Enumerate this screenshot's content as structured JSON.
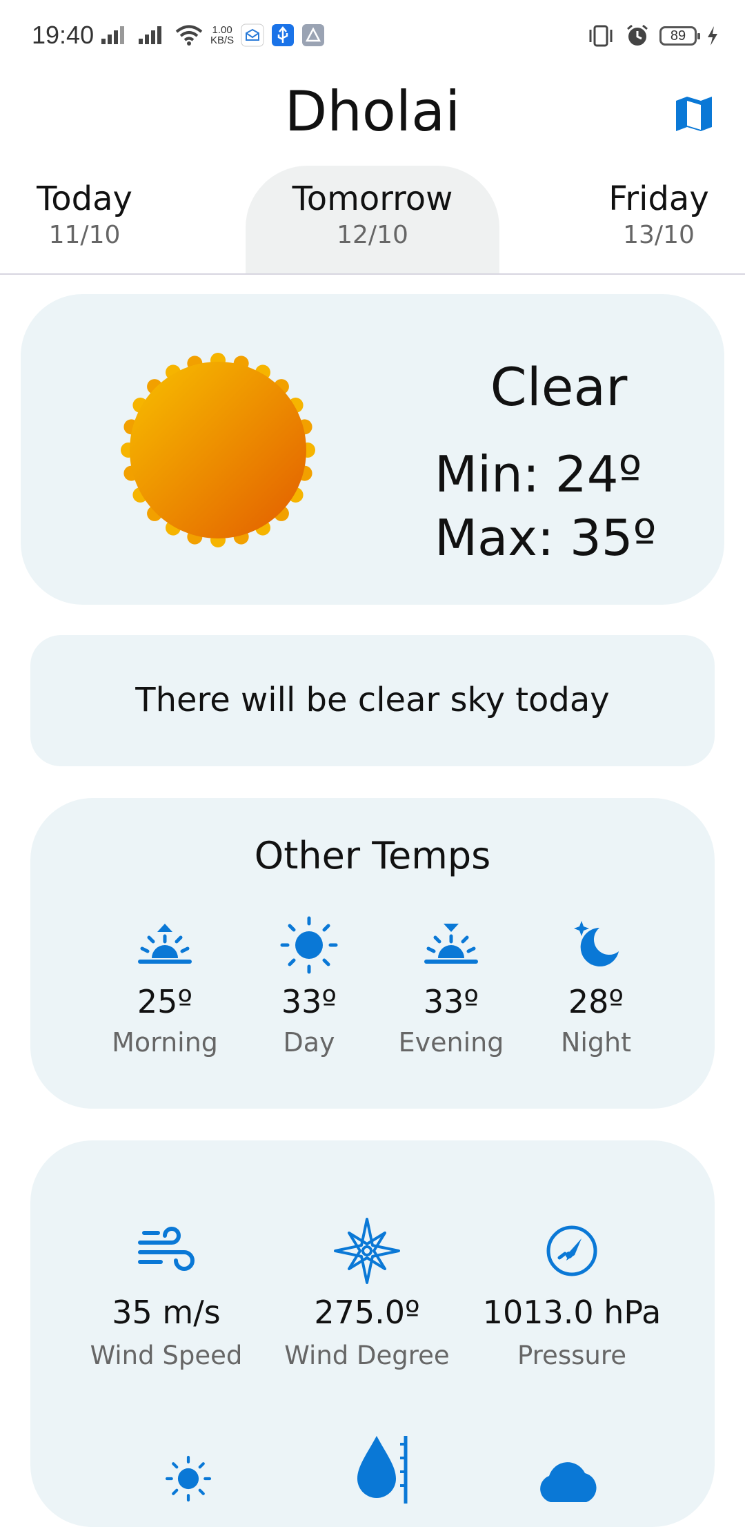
{
  "status_bar": {
    "time": "19:40",
    "net_speed_value": "1.00",
    "net_speed_unit": "KB/S",
    "battery": "89"
  },
  "header": {
    "title": "Dholai",
    "map_icon": "map-icon"
  },
  "tabs": [
    {
      "label": "Today",
      "date": "11/10"
    },
    {
      "label": "Tomorrow",
      "date": "12/10",
      "selected": true
    },
    {
      "label": "Friday",
      "date": "13/10"
    }
  ],
  "summary": {
    "icon": "sun-icon",
    "condition": "Clear",
    "min": "Min: 24º",
    "max": "Max: 35º"
  },
  "description": "There will be clear sky today",
  "other_temps": {
    "title": "Other Temps",
    "items": [
      {
        "icon": "sunrise-icon",
        "temp": "25º",
        "label": "Morning"
      },
      {
        "icon": "sun-icon",
        "temp": "33º",
        "label": "Day"
      },
      {
        "icon": "sunset-icon",
        "temp": "33º",
        "label": "Evening"
      },
      {
        "icon": "moon-icon",
        "temp": "28º",
        "label": "Night"
      }
    ]
  },
  "stats": [
    {
      "icon": "wind-icon",
      "value": "35 m/s",
      "label": "Wind Speed"
    },
    {
      "icon": "compass-rose-icon",
      "value": "275.0º",
      "label": "Wind Degree"
    },
    {
      "icon": "pressure-gauge-icon",
      "value": "1013.0 hPa",
      "label": "Pressure"
    }
  ],
  "stats_row2_icons": [
    "sun-icon",
    "humidity-icon",
    "cloud-icon"
  ],
  "colors": {
    "accent": "#0a78d6",
    "card_bg": "#ecf4f7",
    "selected_tab_bg": "#eff1f1",
    "sun_outer": "#f6b400",
    "sun_inner": "#e66a00"
  }
}
